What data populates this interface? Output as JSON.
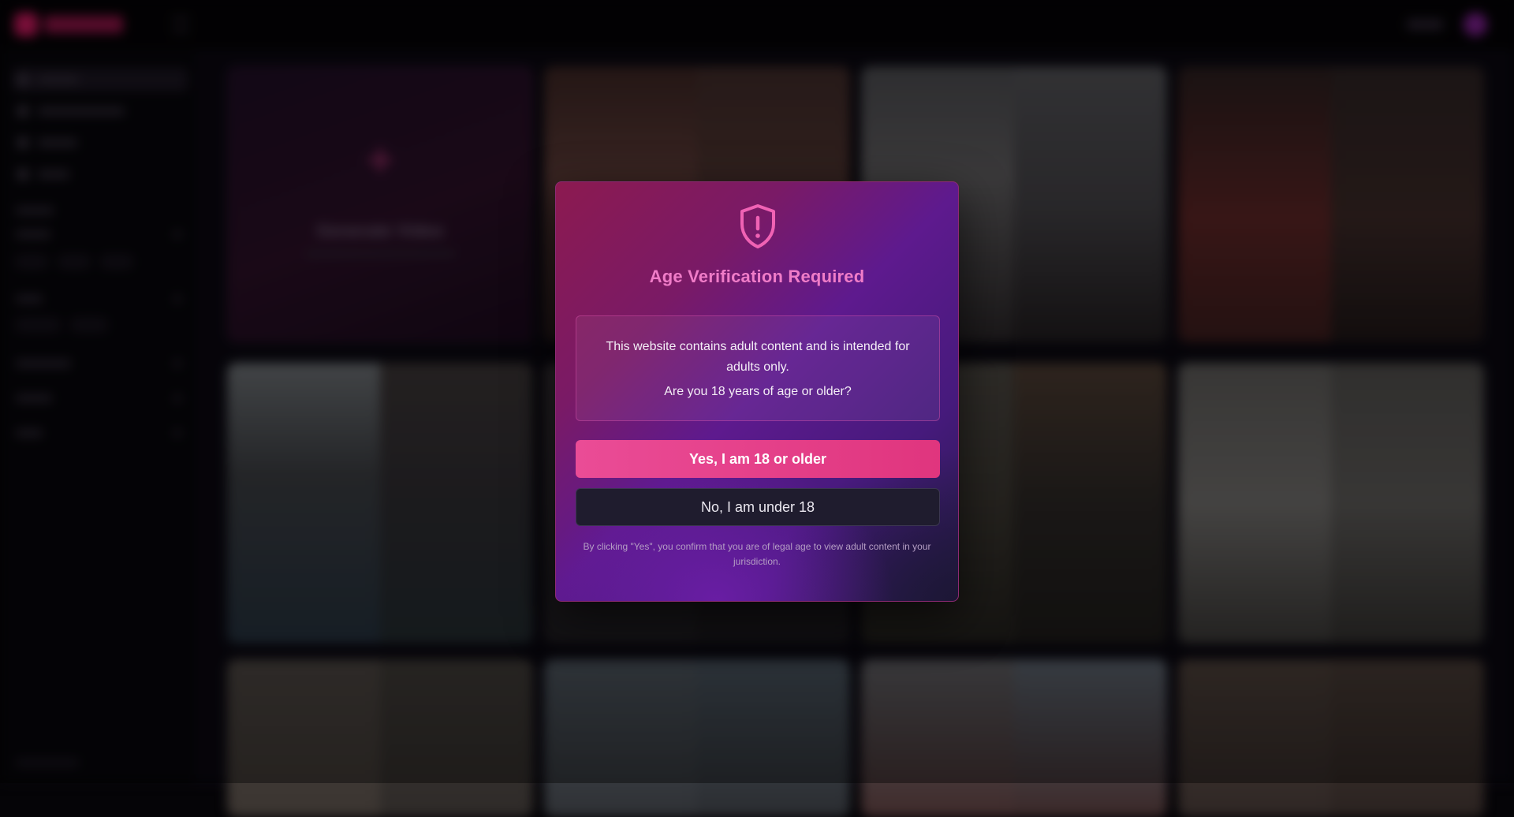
{
  "modal": {
    "title": "Age Verification Required",
    "notice_text": "This website contains adult content and is intended for adults only.",
    "question": "Are you 18 years of age or older?",
    "confirm_label": "Yes, I am 18 or older",
    "deny_label": "No, I am under 18",
    "disclaimer": "By clicking \"Yes\", you confirm that you are of legal age to view adult content in your jurisdiction.",
    "icon": "shield-alert-icon"
  },
  "background": {
    "generate_tile_title": "Generate Video"
  },
  "colors": {
    "accent_pink": "#e0357e",
    "title_pink": "#f07cc8",
    "modal_purple": "#5e1a8e",
    "deny_button_bg": "#1f1c2e"
  }
}
